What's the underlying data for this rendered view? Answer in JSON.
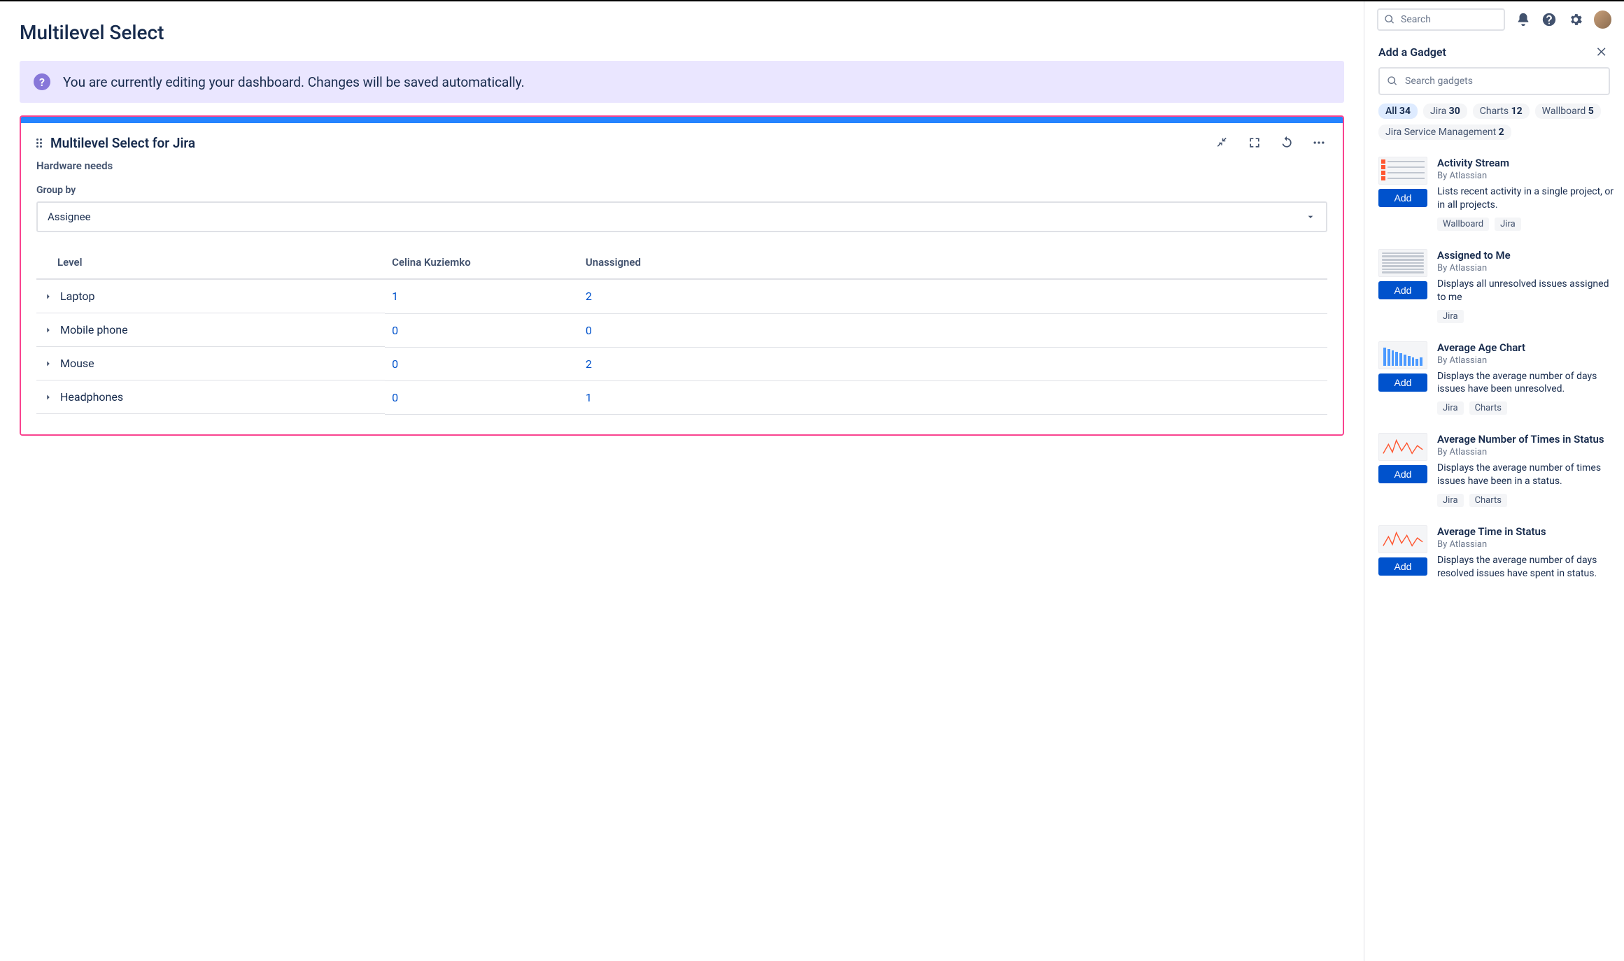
{
  "page": {
    "title": "Multilevel Select"
  },
  "global_search": {
    "placeholder": "Search"
  },
  "banner": {
    "message": "You are currently editing your dashboard. Changes will be saved automatically."
  },
  "gadget": {
    "title": "Multilevel Select for Jira",
    "field_name": "Hardware needs",
    "group_by_label": "Group by",
    "group_by_value": "Assignee",
    "columns": {
      "level": "Level",
      "col1": "Celina Kuziemko",
      "col2": "Unassigned"
    },
    "rows": [
      {
        "label": "Laptop",
        "col1": "1",
        "col2": "2"
      },
      {
        "label": "Mobile phone",
        "col1": "0",
        "col2": "0"
      },
      {
        "label": "Mouse",
        "col1": "0",
        "col2": "2"
      },
      {
        "label": "Headphones",
        "col1": "0",
        "col2": "1"
      }
    ]
  },
  "right": {
    "title": "Add a Gadget",
    "search_placeholder": "Search gadgets",
    "categories": [
      {
        "label": "All",
        "count": "34",
        "active": true
      },
      {
        "label": "Jira",
        "count": "30"
      },
      {
        "label": "Charts",
        "count": "12"
      },
      {
        "label": "Wallboard",
        "count": "5"
      },
      {
        "label": "Jira Service Management",
        "count": "2"
      }
    ],
    "add_label": "Add",
    "gadgets": [
      {
        "name": "Activity Stream",
        "by": "By Atlassian",
        "desc": "Lists recent activity in a single project, or in all projects.",
        "tags": [
          "Wallboard",
          "Jira"
        ],
        "thumb": "activity"
      },
      {
        "name": "Assigned to Me",
        "by": "By Atlassian",
        "desc": "Displays all unresolved issues assigned to me",
        "tags": [
          "Jira"
        ],
        "thumb": "list"
      },
      {
        "name": "Average Age Chart",
        "by": "By Atlassian",
        "desc": "Displays the average number of days issues have been unresolved.",
        "tags": [
          "Jira",
          "Charts"
        ],
        "thumb": "bars"
      },
      {
        "name": "Average Number of Times in Status",
        "by": "By Atlassian",
        "desc": "Displays the average number of times issues have been in a status.",
        "tags": [
          "Jira",
          "Charts"
        ],
        "thumb": "line"
      },
      {
        "name": "Average Time in Status",
        "by": "By Atlassian",
        "desc": "Displays the average number of days resolved issues have spent in status.",
        "tags": [],
        "thumb": "line2"
      }
    ]
  }
}
